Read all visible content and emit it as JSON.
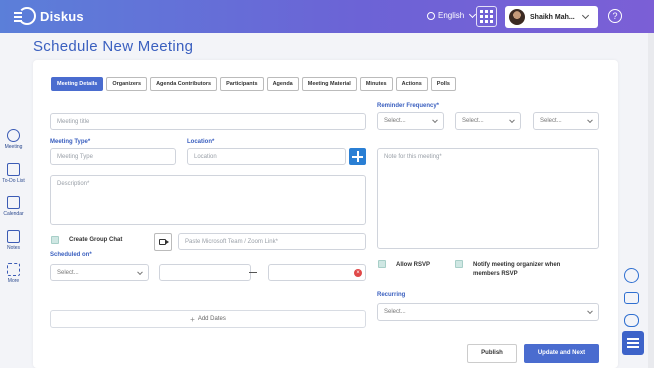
{
  "app": {
    "logo_text": "Diskus"
  },
  "header": {
    "language": "English",
    "user_name": "Shaikh Mah...",
    "help_glyph": "?"
  },
  "sidebar": {
    "items": [
      {
        "label": "Meeting",
        "icon": "meeting-icon"
      },
      {
        "label": "To-Do List",
        "icon": "todo-icon"
      },
      {
        "label": "Calendar",
        "icon": "calendar-icon"
      },
      {
        "label": "Notes",
        "icon": "notes-icon"
      },
      {
        "label": "More",
        "icon": "more-icon"
      }
    ]
  },
  "page": {
    "title": "Schedule New Meeting"
  },
  "tabs": [
    {
      "label": "Meeting Details",
      "active": true
    },
    {
      "label": "Organizers",
      "active": false
    },
    {
      "label": "Agenda Contributors",
      "active": false
    },
    {
      "label": "Participants",
      "active": false
    },
    {
      "label": "Agenda",
      "active": false
    },
    {
      "label": "Meeting Material",
      "active": false
    },
    {
      "label": "Minutes",
      "active": false
    },
    {
      "label": "Actions",
      "active": false
    },
    {
      "label": "Polls",
      "active": false
    }
  ],
  "form": {
    "meeting_title_placeholder": "Meeting title",
    "meeting_type_label": "Meeting Type*",
    "meeting_type_placeholder": "Meeting Type",
    "location_label": "Location*",
    "location_placeholder": "Location",
    "description_placeholder": "Description*",
    "create_group_chat_label": "Create Group Chat",
    "video_link_placeholder": "Paste Microsoft Team / Zoom Link*",
    "scheduled_on_label": "Scheduled on*",
    "scheduled_select": "Select...",
    "add_dates_label": "Add Dates",
    "reminder_label": "Reminder Frequency*",
    "reminder_selects": [
      "Select...",
      "Select...",
      "Select..."
    ],
    "note_placeholder": "Note for this meeting*",
    "allow_rsvp_label": "Allow RSVP",
    "notify_label": "Notify meeting organizer when members RSVP",
    "recurring_label": "Recurring",
    "recurring_select": "Select..."
  },
  "actions": {
    "publish": "Publish",
    "update_next": "Update and Next"
  },
  "colors": {
    "accent": "#4a6ccf",
    "title": "#3a5fbf",
    "plus_button": "#2a7fd4"
  }
}
